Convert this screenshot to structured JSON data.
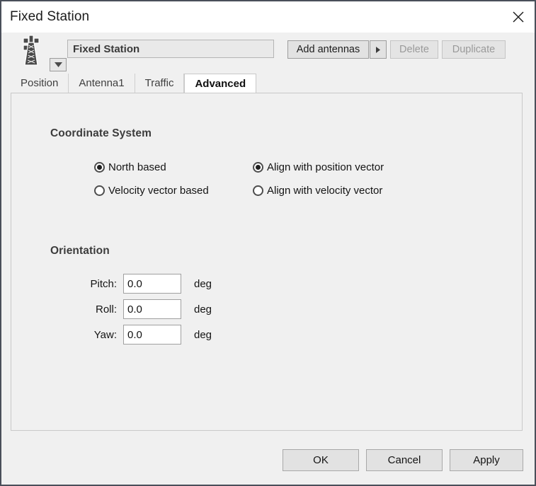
{
  "window": {
    "title": "Fixed Station",
    "close_icon": "close-icon"
  },
  "toolbar": {
    "station_icon": "antenna-tower-icon",
    "dropdown_toggle_icon": "chevron-down-icon",
    "name_value": "Fixed Station",
    "add_antennas_label": "Add antennas",
    "add_antennas_arrow_icon": "chevron-right-icon",
    "delete_label": "Delete",
    "duplicate_label": "Duplicate"
  },
  "tabs": [
    {
      "label": "Position",
      "active": false
    },
    {
      "label": "Antenna1",
      "active": false
    },
    {
      "label": "Traffic",
      "active": false
    },
    {
      "label": "Advanced",
      "active": true
    }
  ],
  "panel": {
    "coordinate_system": {
      "title": "Coordinate System",
      "options_left": [
        {
          "label": "North based",
          "selected": true
        },
        {
          "label": "Velocity vector based",
          "selected": false
        }
      ],
      "options_right": [
        {
          "label": "Align with position vector",
          "selected": true
        },
        {
          "label": "Align with velocity vector",
          "selected": false
        }
      ]
    },
    "orientation": {
      "title": "Orientation",
      "fields": [
        {
          "label": "Pitch:",
          "value": "0.0",
          "unit": "deg"
        },
        {
          "label": "Roll:",
          "value": "0.0",
          "unit": "deg"
        },
        {
          "label": "Yaw:",
          "value": "0.0",
          "unit": "deg"
        }
      ]
    }
  },
  "footer": {
    "ok_label": "OK",
    "cancel_label": "Cancel",
    "apply_label": "Apply"
  },
  "colors": {
    "window_border": "#4a4f5a",
    "background": "#f0f0f0",
    "titlebar": "#ffffff",
    "text": "#141414",
    "disabled_text": "#9a9a9a",
    "active_tab": "#ffffff"
  }
}
